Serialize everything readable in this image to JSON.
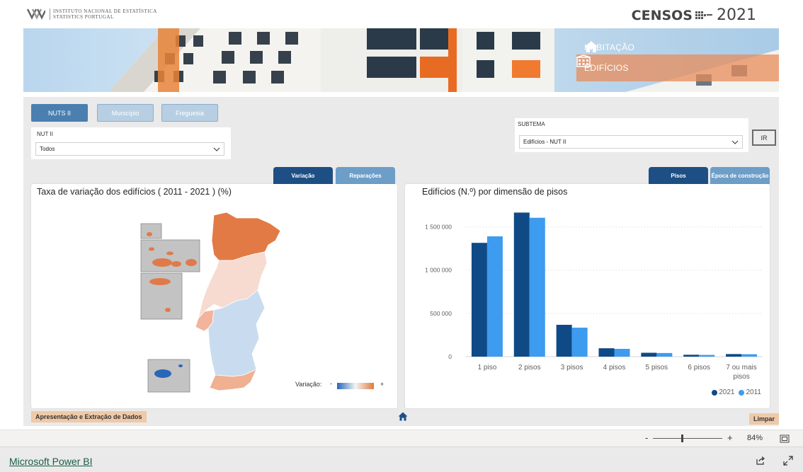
{
  "header": {
    "org_line1": "Instituto Nacional de Estatística",
    "org_line2": "Statistics Portugal",
    "censos_word": "CENSOS",
    "censos_year": "2021"
  },
  "nav": {
    "habitacao": "HABITAÇÃO",
    "edificios": "EDIFÍCIOS"
  },
  "level_tabs": {
    "nuts": "NUTS II",
    "municipio": "Município",
    "freguesia": "Freguesia"
  },
  "filters": {
    "nut_label": "NUT II",
    "nut_value": "Todos",
    "subtema_label": "SUBTEMA",
    "subtema_value": "Edifícios - NUT II",
    "ir_button": "IR"
  },
  "map_tabs": {
    "variacao": "Variação",
    "reparacoes": "Reparações"
  },
  "chart_tabs": {
    "pisos": "Pisos",
    "epoca": "Época de construção"
  },
  "map_card": {
    "title": "Taxa de variação dos edifícios ( 2011 - 2021 ) (%)",
    "legend_label": "Variação:",
    "legend_min": "-",
    "legend_max": "+"
  },
  "chart_data": {
    "type": "bar",
    "title": "Edifícios (N.º) por dimensão de pisos",
    "categories": [
      "1 piso",
      "2 pisos",
      "3 pisos",
      "4 pisos",
      "5 pisos",
      "6 pisos",
      "7 ou mais pisos"
    ],
    "series": [
      {
        "name": "2021",
        "color": "#0f4a86",
        "values": [
          1315000,
          1665000,
          368000,
          97000,
          45000,
          22000,
          30000
        ]
      },
      {
        "name": "2011",
        "color": "#3d9bf0",
        "values": [
          1390000,
          1605000,
          335000,
          90000,
          42000,
          20000,
          28000
        ]
      }
    ],
    "yticks": [
      "0",
      "500 000",
      "1 000 000",
      "1 500 000"
    ],
    "ytick_values": [
      0,
      500000,
      1000000,
      1500000
    ],
    "ylim": [
      0,
      1750000
    ],
    "grid": true,
    "legend_position": "bottom-right"
  },
  "footer": {
    "apresentacao": "Apresentação e Extração de Dados",
    "limpar": "Limpar"
  },
  "statusbar": {
    "zoom_minus": "-",
    "zoom_plus": "+",
    "zoom_value": "84%"
  },
  "powerbi": {
    "link": "Microsoft Power BI"
  }
}
